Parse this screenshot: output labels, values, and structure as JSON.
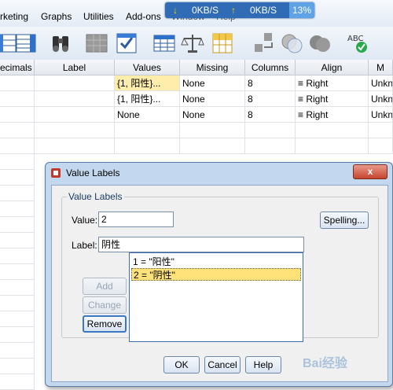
{
  "menubar": {
    "items": [
      "rketing",
      "Graphs",
      "Utilities",
      "Add-ons",
      "Window",
      "Help"
    ]
  },
  "netmeter": {
    "down": "0KB/S",
    "up": "0KB/S",
    "percent": "13%"
  },
  "toolbar": {
    "icons": [
      "variable-view-icon",
      "find-icon",
      "insert-cases-icon",
      "insert-variable-icon",
      "split-file-icon",
      "weight-cases-icon",
      "select-cases-icon",
      "value-labels-icon",
      "use-sets-icon",
      "show-all-icon",
      "spelling-icon"
    ]
  },
  "grid": {
    "headers": [
      "ecimals",
      "Label",
      "Values",
      "Missing",
      "Columns",
      "Align",
      "M"
    ],
    "rows": [
      [
        "",
        "",
        "{1, 阳性}...",
        "None",
        "8",
        "Right",
        "Unkn"
      ],
      [
        "",
        "",
        "{1, 阳性}...",
        "None",
        "8",
        "Right",
        "Unkn"
      ],
      [
        "",
        "",
        "None",
        "None",
        "8",
        "Right",
        "Unkn"
      ]
    ]
  },
  "dialog": {
    "title": "Value Labels",
    "close_label": "x",
    "group_title": "Value Labels",
    "value_label": "Value:",
    "value_input": "2",
    "label_label": "Label:",
    "label_input": "阴性",
    "spelling_button": "Spelling...",
    "add_button": "Add",
    "change_button": "Change",
    "remove_button": "Remove",
    "list_items": [
      "1 = \"阳性\"",
      "2 = \"阴性\""
    ],
    "ok_button": "OK",
    "cancel_button": "Cancel",
    "help_button": "Help"
  },
  "watermark": "Bai经验",
  "colors": {
    "highlight": "#ffeeab",
    "list_selected": "#ffe37a",
    "dialog_frame": "#c3d7ee",
    "netbar": "#2f6cb5"
  }
}
